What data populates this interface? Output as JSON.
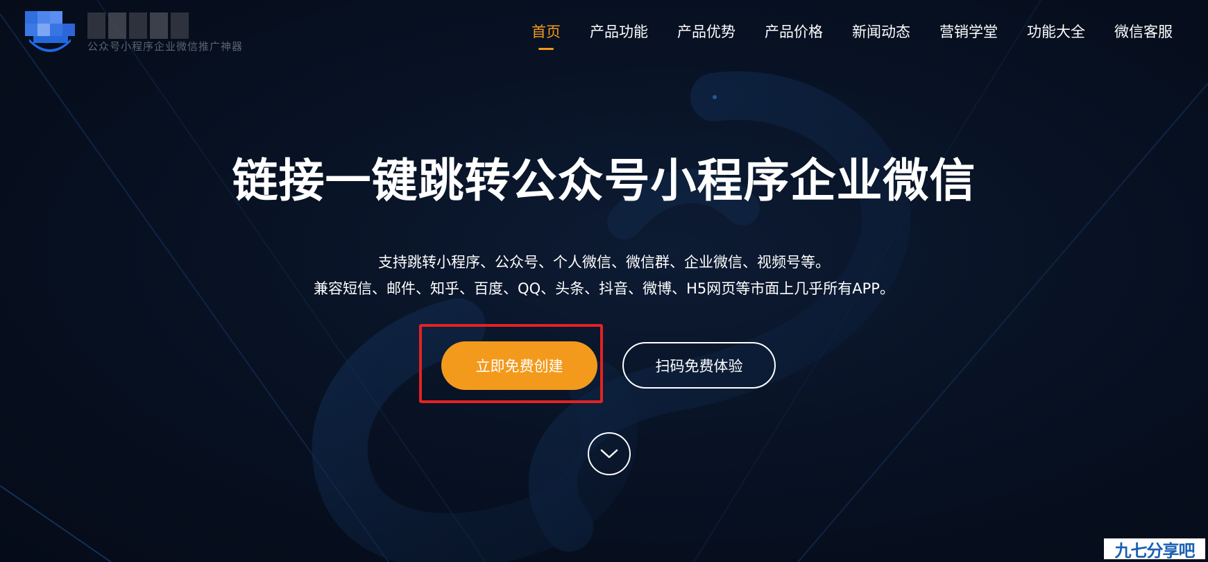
{
  "header": {
    "logo_tagline": "公众号小程序企业微信推广神器",
    "nav": [
      {
        "label": "首页",
        "active": true
      },
      {
        "label": "产品功能",
        "active": false
      },
      {
        "label": "产品优势",
        "active": false
      },
      {
        "label": "产品价格",
        "active": false
      },
      {
        "label": "新闻动态",
        "active": false
      },
      {
        "label": "营销学堂",
        "active": false
      },
      {
        "label": "功能大全",
        "active": false
      },
      {
        "label": "微信客服",
        "active": false
      }
    ]
  },
  "hero": {
    "title": "链接一键跳转公众号小程序企业微信",
    "subtitle_line1": "支持跳转小程序、公众号、个人微信、微信群、企业微信、视频号等。",
    "subtitle_line2": "兼容短信、邮件、知乎、百度、QQ、头条、抖音、微博、H5网页等市面上几乎所有APP。",
    "primary_button": "立即免费创建",
    "secondary_button": "扫码免费体验"
  },
  "watermark": "九七分享吧",
  "colors": {
    "accent": "#f39a1c",
    "background": "#07101f",
    "highlight": "#e52222"
  },
  "icons": {
    "scroll": "chevron-down-icon",
    "logo": "logo-icon"
  }
}
